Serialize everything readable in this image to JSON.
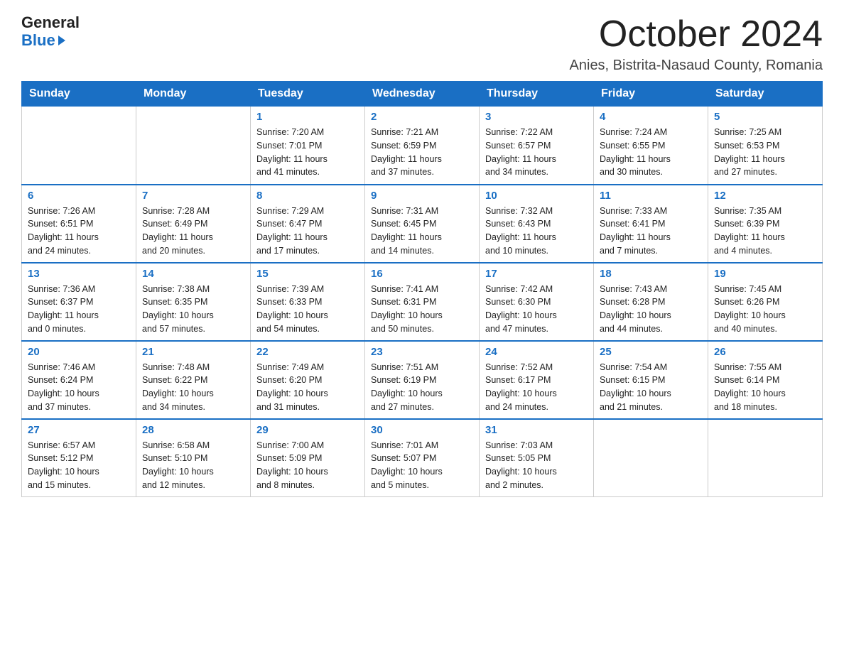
{
  "logo": {
    "general": "General",
    "blue": "Blue"
  },
  "header": {
    "month": "October 2024",
    "location": "Anies, Bistrita-Nasaud County, Romania"
  },
  "weekdays": [
    "Sunday",
    "Monday",
    "Tuesday",
    "Wednesday",
    "Thursday",
    "Friday",
    "Saturday"
  ],
  "weeks": [
    [
      {
        "day": "",
        "info": ""
      },
      {
        "day": "",
        "info": ""
      },
      {
        "day": "1",
        "info": "Sunrise: 7:20 AM\nSunset: 7:01 PM\nDaylight: 11 hours\nand 41 minutes."
      },
      {
        "day": "2",
        "info": "Sunrise: 7:21 AM\nSunset: 6:59 PM\nDaylight: 11 hours\nand 37 minutes."
      },
      {
        "day": "3",
        "info": "Sunrise: 7:22 AM\nSunset: 6:57 PM\nDaylight: 11 hours\nand 34 minutes."
      },
      {
        "day": "4",
        "info": "Sunrise: 7:24 AM\nSunset: 6:55 PM\nDaylight: 11 hours\nand 30 minutes."
      },
      {
        "day": "5",
        "info": "Sunrise: 7:25 AM\nSunset: 6:53 PM\nDaylight: 11 hours\nand 27 minutes."
      }
    ],
    [
      {
        "day": "6",
        "info": "Sunrise: 7:26 AM\nSunset: 6:51 PM\nDaylight: 11 hours\nand 24 minutes."
      },
      {
        "day": "7",
        "info": "Sunrise: 7:28 AM\nSunset: 6:49 PM\nDaylight: 11 hours\nand 20 minutes."
      },
      {
        "day": "8",
        "info": "Sunrise: 7:29 AM\nSunset: 6:47 PM\nDaylight: 11 hours\nand 17 minutes."
      },
      {
        "day": "9",
        "info": "Sunrise: 7:31 AM\nSunset: 6:45 PM\nDaylight: 11 hours\nand 14 minutes."
      },
      {
        "day": "10",
        "info": "Sunrise: 7:32 AM\nSunset: 6:43 PM\nDaylight: 11 hours\nand 10 minutes."
      },
      {
        "day": "11",
        "info": "Sunrise: 7:33 AM\nSunset: 6:41 PM\nDaylight: 11 hours\nand 7 minutes."
      },
      {
        "day": "12",
        "info": "Sunrise: 7:35 AM\nSunset: 6:39 PM\nDaylight: 11 hours\nand 4 minutes."
      }
    ],
    [
      {
        "day": "13",
        "info": "Sunrise: 7:36 AM\nSunset: 6:37 PM\nDaylight: 11 hours\nand 0 minutes."
      },
      {
        "day": "14",
        "info": "Sunrise: 7:38 AM\nSunset: 6:35 PM\nDaylight: 10 hours\nand 57 minutes."
      },
      {
        "day": "15",
        "info": "Sunrise: 7:39 AM\nSunset: 6:33 PM\nDaylight: 10 hours\nand 54 minutes."
      },
      {
        "day": "16",
        "info": "Sunrise: 7:41 AM\nSunset: 6:31 PM\nDaylight: 10 hours\nand 50 minutes."
      },
      {
        "day": "17",
        "info": "Sunrise: 7:42 AM\nSunset: 6:30 PM\nDaylight: 10 hours\nand 47 minutes."
      },
      {
        "day": "18",
        "info": "Sunrise: 7:43 AM\nSunset: 6:28 PM\nDaylight: 10 hours\nand 44 minutes."
      },
      {
        "day": "19",
        "info": "Sunrise: 7:45 AM\nSunset: 6:26 PM\nDaylight: 10 hours\nand 40 minutes."
      }
    ],
    [
      {
        "day": "20",
        "info": "Sunrise: 7:46 AM\nSunset: 6:24 PM\nDaylight: 10 hours\nand 37 minutes."
      },
      {
        "day": "21",
        "info": "Sunrise: 7:48 AM\nSunset: 6:22 PM\nDaylight: 10 hours\nand 34 minutes."
      },
      {
        "day": "22",
        "info": "Sunrise: 7:49 AM\nSunset: 6:20 PM\nDaylight: 10 hours\nand 31 minutes."
      },
      {
        "day": "23",
        "info": "Sunrise: 7:51 AM\nSunset: 6:19 PM\nDaylight: 10 hours\nand 27 minutes."
      },
      {
        "day": "24",
        "info": "Sunrise: 7:52 AM\nSunset: 6:17 PM\nDaylight: 10 hours\nand 24 minutes."
      },
      {
        "day": "25",
        "info": "Sunrise: 7:54 AM\nSunset: 6:15 PM\nDaylight: 10 hours\nand 21 minutes."
      },
      {
        "day": "26",
        "info": "Sunrise: 7:55 AM\nSunset: 6:14 PM\nDaylight: 10 hours\nand 18 minutes."
      }
    ],
    [
      {
        "day": "27",
        "info": "Sunrise: 6:57 AM\nSunset: 5:12 PM\nDaylight: 10 hours\nand 15 minutes."
      },
      {
        "day": "28",
        "info": "Sunrise: 6:58 AM\nSunset: 5:10 PM\nDaylight: 10 hours\nand 12 minutes."
      },
      {
        "day": "29",
        "info": "Sunrise: 7:00 AM\nSunset: 5:09 PM\nDaylight: 10 hours\nand 8 minutes."
      },
      {
        "day": "30",
        "info": "Sunrise: 7:01 AM\nSunset: 5:07 PM\nDaylight: 10 hours\nand 5 minutes."
      },
      {
        "day": "31",
        "info": "Sunrise: 7:03 AM\nSunset: 5:05 PM\nDaylight: 10 hours\nand 2 minutes."
      },
      {
        "day": "",
        "info": ""
      },
      {
        "day": "",
        "info": ""
      }
    ]
  ]
}
